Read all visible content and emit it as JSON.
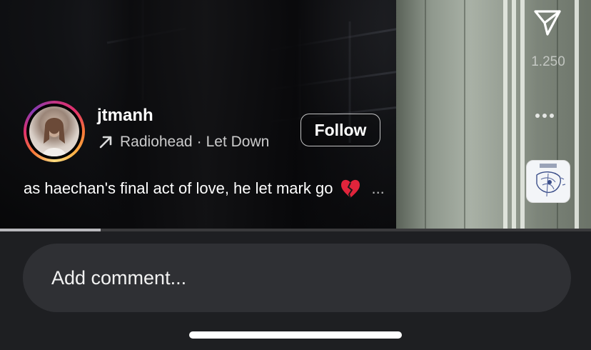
{
  "post": {
    "username": "jtmanh",
    "audio": {
      "artist": "Radiohead",
      "separator": "·",
      "track": "Let Down"
    },
    "follow_label": "Follow",
    "caption": "as haechan's final act of love, he let mark go",
    "caption_more": "..."
  },
  "actions": {
    "share_count": "1.250"
  },
  "playback": {
    "progress_fraction": 0.17
  },
  "comment": {
    "placeholder": "Add comment..."
  },
  "icons": {
    "share": "paper-plane-icon",
    "more": "more-dots-icon",
    "audio": "arrow-up-right-icon",
    "caption_emoji": "broken-heart-icon"
  },
  "colors": {
    "accent_ring": [
      "#c13584",
      "#f77737",
      "#fcaf45"
    ],
    "broken_heart": "#e0243b",
    "progress_fill": "#b8b8bc",
    "comment_box": "#2f3034"
  }
}
